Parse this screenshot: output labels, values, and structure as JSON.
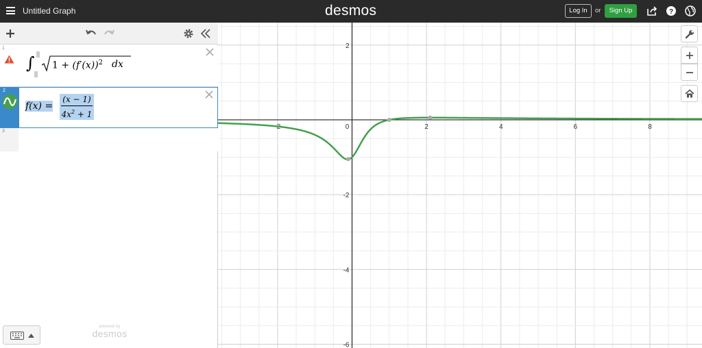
{
  "topbar": {
    "title": "Untitled Graph",
    "logo": "desmos",
    "login_label": "Log In",
    "or_label": "or",
    "signup_label": "Sign Up",
    "icons": [
      "menu-icon",
      "share-icon",
      "help-icon",
      "language-icon"
    ]
  },
  "expressions_panel": {
    "header_icons": [
      "add-icon",
      "undo-icon",
      "redo-icon",
      "settings-icon",
      "collapse-icon"
    ],
    "expressions": [
      {
        "number": "1",
        "status_icon": "warning-icon",
        "latex": "\\int_{}^{} \\sqrt{1+(f'(x))^2} dx",
        "parts": {
          "integral": "∫",
          "one_plus": "1 + ",
          "f_prime": "(f′(x))",
          "exp": "2",
          "dx": "dx"
        }
      },
      {
        "number": "2",
        "status_icon": "graph-curve-icon",
        "latex": "f(x)=\\frac{(x-1)}{4x^2+1}",
        "parts": {
          "lhs": "f(x) =",
          "numerator": "(x − 1)",
          "denominator": "4x",
          "den_exp": "2",
          "den_tail": " + 1"
        }
      },
      {
        "number": "3"
      }
    ],
    "keyboard_icon": "keyboard-icon",
    "powered_by": "powered by",
    "powered_logo": "desmos"
  },
  "graph_controls": {
    "icons": [
      "wrench-icon",
      "zoom-in-icon",
      "zoom-out-icon",
      "home-icon"
    ]
  },
  "colors": {
    "curve": "#44a04d",
    "selection": "#3a89c9",
    "warning": "#e04e2f",
    "signup": "#2f9f41"
  },
  "chart_data": {
    "type": "line",
    "function": "f(x) = (x-1)/(4x^2+1)",
    "xlim": [
      -3.6,
      9.4
    ],
    "ylim": [
      -6.1,
      2.6
    ],
    "x_ticks": [
      "-2",
      "0",
      "2",
      "4",
      "6",
      "8"
    ],
    "y_ticks": [
      "2",
      "-2",
      "-4",
      "-6"
    ],
    "grid": true,
    "points_of_interest": [
      {
        "label": "minimum",
        "x": -0.1,
        "y": -1.05
      },
      {
        "label": "zero",
        "x": 1,
        "y": 0
      },
      {
        "label": "maximum",
        "x": 2.1,
        "y": 0.06
      }
    ]
  }
}
